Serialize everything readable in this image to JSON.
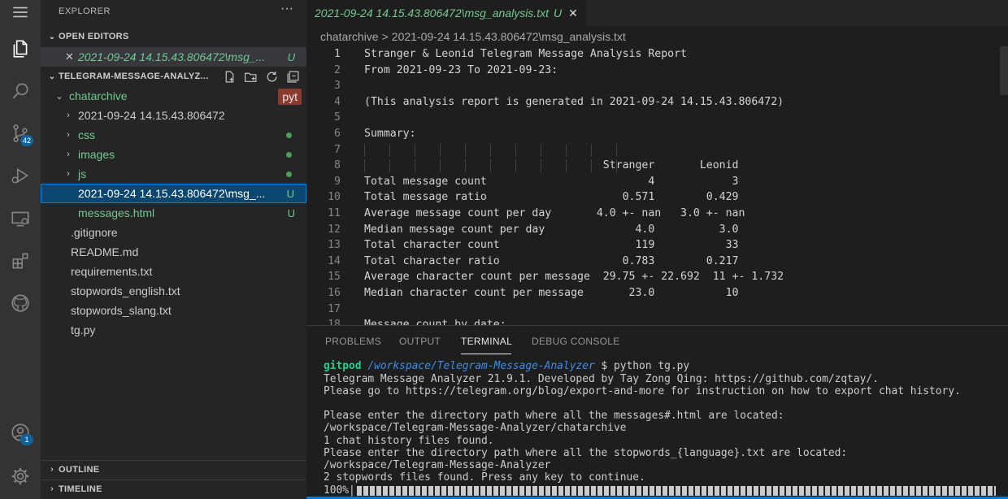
{
  "activity_bar": {
    "icons": [
      "menu-icon",
      "files-icon",
      "search-icon",
      "source-control-icon",
      "run-debug-icon",
      "remote-explorer-icon",
      "extensions-icon",
      "github-icon",
      "account-icon",
      "settings-gear-icon"
    ],
    "source_control_badge": "42",
    "account_badge": "1"
  },
  "sidebar": {
    "title": "EXPLORER",
    "more": "···",
    "open_editors": {
      "header": "OPEN EDITORS",
      "items": [
        {
          "close": "✕",
          "name": "2021-09-24 14.15.43.806472\\msg_...",
          "status": "U"
        }
      ]
    },
    "workspace": {
      "header": "TELEGRAM-MESSAGE-ANALYZ...",
      "tag": "pyt",
      "folder": "chatarchive",
      "folder_items": [
        {
          "name": "2021-09-24 14.15.43.806472",
          "status": ""
        },
        {
          "name": "css",
          "status": ""
        },
        {
          "name": "images",
          "status": ""
        },
        {
          "name": "js",
          "status": ""
        },
        {
          "name": "2021-09-24 14.15.43.806472\\msg_...",
          "status": "U"
        },
        {
          "name": "messages.html",
          "status": "U"
        }
      ],
      "root_files": [
        ".gitignore",
        "README.md",
        "requirements.txt",
        "stopwords_english.txt",
        "stopwords_slang.txt",
        "tg.py"
      ]
    },
    "outline": "OUTLINE",
    "timeline": "TIMELINE"
  },
  "editor": {
    "tab": {
      "name": "2021-09-24 14.15.43.806472\\msg_analysis.txt",
      "status": "U",
      "close": "✕"
    },
    "breadcrumb": {
      "folder": "chatarchive",
      "sep": ">",
      "file": "2021-09-24 14.15.43.806472\\msg_analysis.txt"
    },
    "lines": [
      {
        "n": "1",
        "t": "Stranger & Leonid Telegram Message Analysis Report"
      },
      {
        "n": "2",
        "t": "From 2021-09-23 To 2021-09-23:"
      },
      {
        "n": "3",
        "t": ""
      },
      {
        "n": "4",
        "t": "(This analysis report is generated in 2021-09-24 14.15.43.806472)"
      },
      {
        "n": "5",
        "t": ""
      },
      {
        "n": "6",
        "t": "Summary:"
      },
      {
        "n": "7",
        "t": ""
      },
      {
        "n": "8",
        "t": "                                     Stranger       Leonid"
      },
      {
        "n": "9",
        "t": "Total message count                         4            3"
      },
      {
        "n": "10",
        "t": "Total message ratio                     0.571        0.429"
      },
      {
        "n": "11",
        "t": "Average message count per day       4.0 +- nan   3.0 +- nan"
      },
      {
        "n": "12",
        "t": "Median message count per day              4.0          3.0"
      },
      {
        "n": "13",
        "t": "Total character count                     119           33"
      },
      {
        "n": "14",
        "t": "Total character ratio                   0.783        0.217"
      },
      {
        "n": "15",
        "t": "Average character count per message  29.75 +- 22.692  11 +- 1.732"
      },
      {
        "n": "16",
        "t": "Median character count per message       23.0           10"
      },
      {
        "n": "17",
        "t": ""
      },
      {
        "n": "18",
        "t": "Message count by date:"
      }
    ]
  },
  "panel": {
    "tabs": [
      "PROBLEMS",
      "OUTPUT",
      "TERMINAL",
      "DEBUG CONSOLE"
    ],
    "active_tab": "TERMINAL",
    "terminal": {
      "prompt_user": "gitpod",
      "prompt_path": "/workspace/Telegram-Message-Analyzer",
      "prompt_cmd": " $ python tg.py",
      "lines": [
        "Telegram Message Analyzer 21.9.1. Developed by Tay Zong Qing: https://github.com/zqtay/.",
        "Please go to https://telegram.org/blog/export-and-more for instruction on how to export chat history.",
        "",
        "Please enter the directory path where all the messages#.html are located:",
        "/workspace/Telegram-Message-Analyzer/chatarchive",
        "1 chat history files found.",
        "Please enter the directory path where all the stopwords_{language}.txt are located:",
        "/workspace/Telegram-Message-Analyzer",
        "2 stopwords files found. Press any key to continue."
      ],
      "progress_label": "100%|",
      "progress_value": 1.0
    }
  },
  "colors": {
    "activity_bg": "#333333",
    "sidebar_bg": "#252526",
    "editor_bg": "#1e1e1e",
    "untracked": "#73c991",
    "selection": "#094771",
    "accent": "#007acc"
  }
}
